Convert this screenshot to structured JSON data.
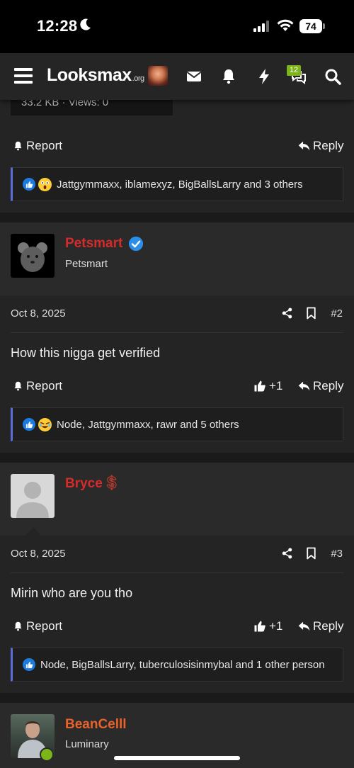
{
  "status_bar": {
    "time": "12:28",
    "battery": "74"
  },
  "nav": {
    "logo_main": "Looksmax",
    "logo_suffix": ".org",
    "icons": [
      "menu-icon",
      "mail-icon",
      "bell-icon",
      "bolt-icon",
      "chat-icon",
      "search-icon"
    ],
    "chat_badge": "12"
  },
  "attachment": {
    "text": "33.2 KB · Views: 0"
  },
  "posts": [
    {
      "report_label": "Report",
      "reply_label": "Reply",
      "reactions": "Jattgymmaxx, iblamexyz, BigBallsLarry and 3 others"
    },
    {
      "username": "Petsmart",
      "user_title": "Petsmart",
      "date": "Oct 8, 2025",
      "number": "#2",
      "body": "How this nigga get verified",
      "report_label": "Report",
      "plus_label": "+1",
      "reply_label": "Reply",
      "reactions": "Node, Jattgymmaxx, rawr and 5 others"
    },
    {
      "username": "Bryce",
      "user_badge": "$",
      "date": "Oct 8, 2025",
      "number": "#3",
      "body": "Mirin who are you tho",
      "report_label": "Report",
      "plus_label": "+1",
      "reply_label": "Reply",
      "reactions": "Node, BigBallsLarry, tuberculosisinmybal and 1 other person"
    },
    {
      "username": "BeanCelll",
      "user_title": "Luminary"
    }
  ],
  "colors": {
    "accent": "#5a6fd6",
    "username_red": "#d52b2b",
    "username_orange": "#e8622a",
    "verified_blue": "#2b8ee8",
    "badge_green": "#7cb518"
  }
}
